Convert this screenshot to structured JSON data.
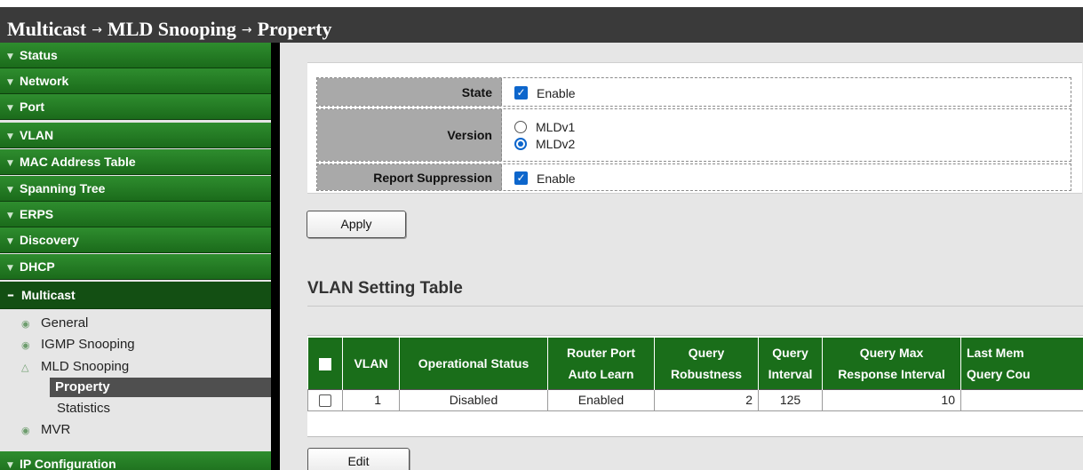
{
  "breadcrumb": {
    "part1": "Multicast",
    "part2": "MLD Snooping",
    "part3": "Property",
    "separator": "→"
  },
  "sidebar": {
    "items": [
      {
        "label": "Status"
      },
      {
        "label": "Network"
      },
      {
        "label": "Port"
      },
      {
        "label": "VLAN"
      },
      {
        "label": "MAC Address Table"
      },
      {
        "label": "Spanning Tree"
      },
      {
        "label": "ERPS"
      },
      {
        "label": "Discovery"
      },
      {
        "label": "DHCP"
      },
      {
        "label": "Multicast"
      },
      {
        "label": "IP Configuration"
      }
    ],
    "multicast_sub": [
      {
        "label": "General"
      },
      {
        "label": "IGMP Snooping"
      },
      {
        "label": "MLD Snooping"
      },
      {
        "label": "MVR"
      }
    ],
    "mld_sub": [
      {
        "label": "Property"
      },
      {
        "label": "Statistics"
      }
    ]
  },
  "form": {
    "state_label": "State",
    "state_option": "Enable",
    "state_checked": true,
    "version_label": "Version",
    "version_options": [
      "MLDv1",
      "MLDv2"
    ],
    "version_selected": "MLDv2",
    "report_label": "Report Suppression",
    "report_option": "Enable",
    "report_checked": true
  },
  "buttons": {
    "apply": "Apply",
    "edit": "Edit"
  },
  "table": {
    "title": "VLAN Setting Table",
    "headers": {
      "vlan": "VLAN",
      "op_status": "Operational Status",
      "router_port_1": "Router Port",
      "router_port_2": "Auto Learn",
      "query_rob_1": "Query",
      "query_rob_2": "Robustness",
      "query_int_1": "Query",
      "query_int_2": "Interval",
      "query_max_1": "Query Max",
      "query_max_2": "Response Interval",
      "last_mem_1": "Last Mem",
      "last_mem_2": "Query Cou"
    },
    "rows": [
      {
        "vlan": "1",
        "op_status": "Disabled",
        "router_port": "Enabled",
        "robustness": "2",
        "interval": "125",
        "max_response": "10",
        "last_member": ""
      }
    ]
  },
  "colors": {
    "nav_green": "#1b6b1b",
    "table_header": "#1a6e1a",
    "accent_blue": "#0d66cc"
  }
}
